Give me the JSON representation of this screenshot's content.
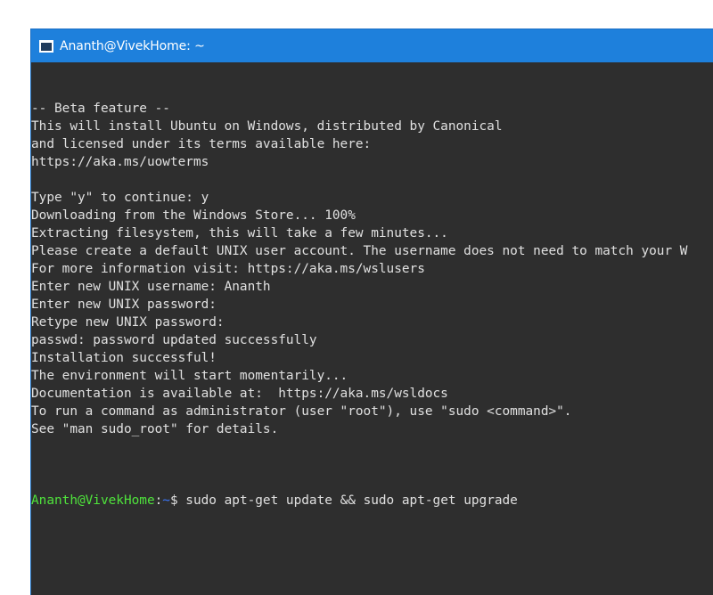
{
  "window": {
    "title": "Ananth@VivekHome: ~",
    "icon": "terminal-icon",
    "colors": {
      "titlebar": "#1e80dc",
      "background": "#2e2e2e",
      "text": "#e0e0e0",
      "prompt_user": "#4fe33c",
      "prompt_path": "#3b78ff"
    }
  },
  "terminal": {
    "lines": [
      "-- Beta feature --",
      "This will install Ubuntu on Windows, distributed by Canonical",
      "and licensed under its terms available here:",
      "https://aka.ms/uowterms",
      "",
      "Type \"y\" to continue: y",
      "Downloading from the Windows Store... 100%",
      "Extracting filesystem, this will take a few minutes...",
      "Please create a default UNIX user account. The username does not need to match your W",
      "For more information visit: https://aka.ms/wslusers",
      "Enter new UNIX username: Ananth",
      "Enter new UNIX password:",
      "Retype new UNIX password:",
      "passwd: password updated successfully",
      "Installation successful!",
      "The environment will start momentarily...",
      "Documentation is available at:  https://aka.ms/wsldocs",
      "To run a command as administrator (user \"root\"), use \"sudo <command>\".",
      "See \"man sudo_root\" for details.",
      ""
    ],
    "prompt": {
      "user_host": "Ananth@VivekHome",
      "separator": ":",
      "path": "~",
      "symbol": "$ ",
      "command": "sudo apt-get update && sudo apt-get upgrade"
    }
  }
}
